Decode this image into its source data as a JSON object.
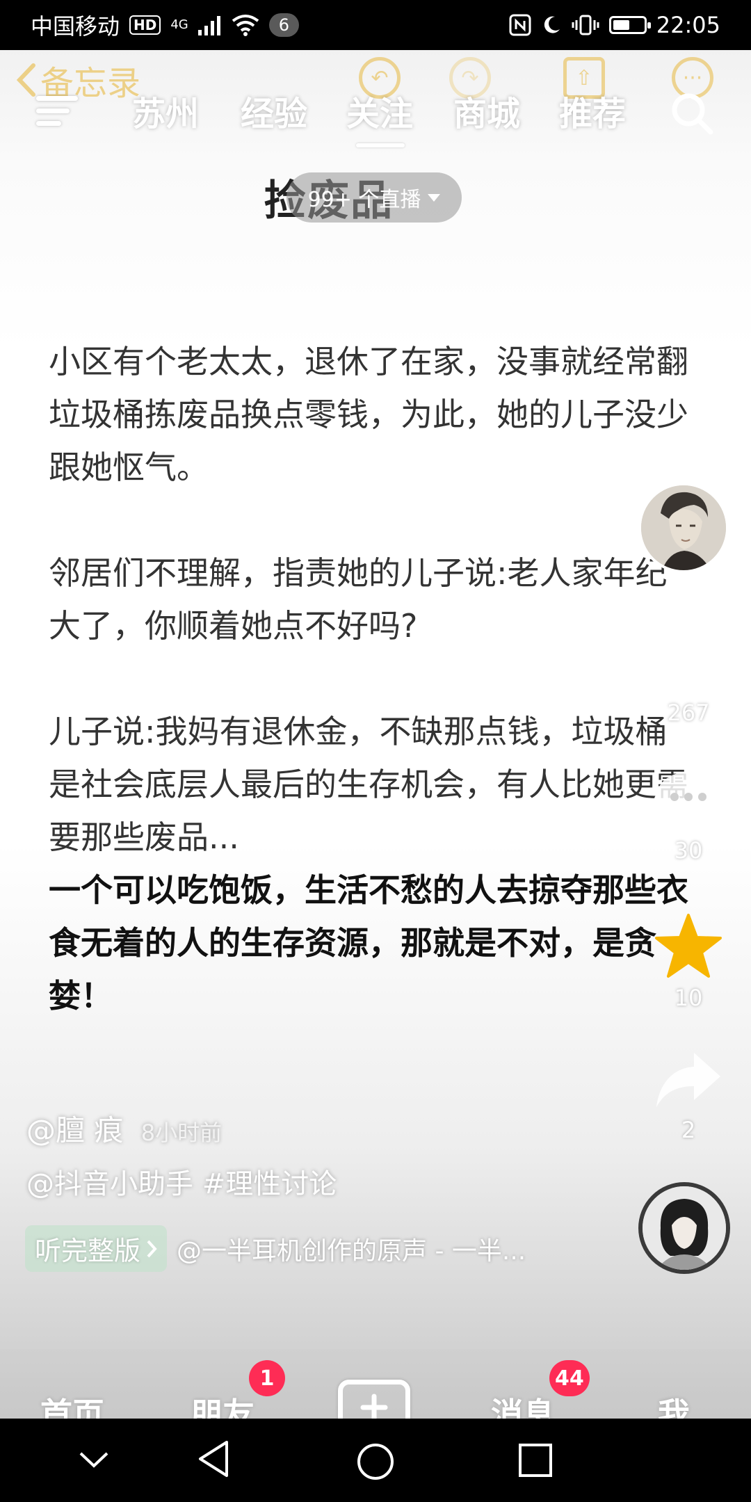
{
  "status_bar": {
    "carrier": "中国移动",
    "hd": "HD",
    "network": "4G",
    "notification_count": "6",
    "time": "22:05",
    "battery_level": 0.55
  },
  "memo": {
    "back_label": "备忘录"
  },
  "top_nav": {
    "tabs": [
      "苏州",
      "经验",
      "关注",
      "商城",
      "推荐"
    ],
    "active_tab": "关注"
  },
  "article": {
    "title": "捡废品",
    "paragraphs": [
      "小区有个老太太，退休了在家，没事就经常翻垃圾桶拣废品换点零钱，为此，她的儿子没少跟她怄气。",
      "邻居们不理解，指责她的儿子说:老人家年纪大了，你顺着她点不好吗?",
      "儿子说:我妈有退休金，不缺那点钱，垃圾桶是社会底层人最后的生存机会，有人比她更需要那些废品..."
    ],
    "bold_paragraph": "一个可以吃饱饭，生活不愁的人去掠夺那些衣食无着的人的生存资源，那就是不对，是贪婪！"
  },
  "live": {
    "label": "99+ 个直播"
  },
  "rail": {
    "likes": "267",
    "comments": "30",
    "favorites": "10",
    "shares": "2",
    "favorite_color": "#f7b500"
  },
  "post": {
    "author": "@膻 痕",
    "time": "8小时前",
    "description": "@抖音小助手 #理性讨论",
    "full_version_label": "听完整版",
    "music": "@一半耳机创作的原声 - 一半..."
  },
  "bottom_nav": {
    "home": "首页",
    "friends": "朋友",
    "friends_badge": "1",
    "messages": "消息",
    "messages_badge": "44",
    "me": "我",
    "badge_color": "#fe2c55"
  }
}
